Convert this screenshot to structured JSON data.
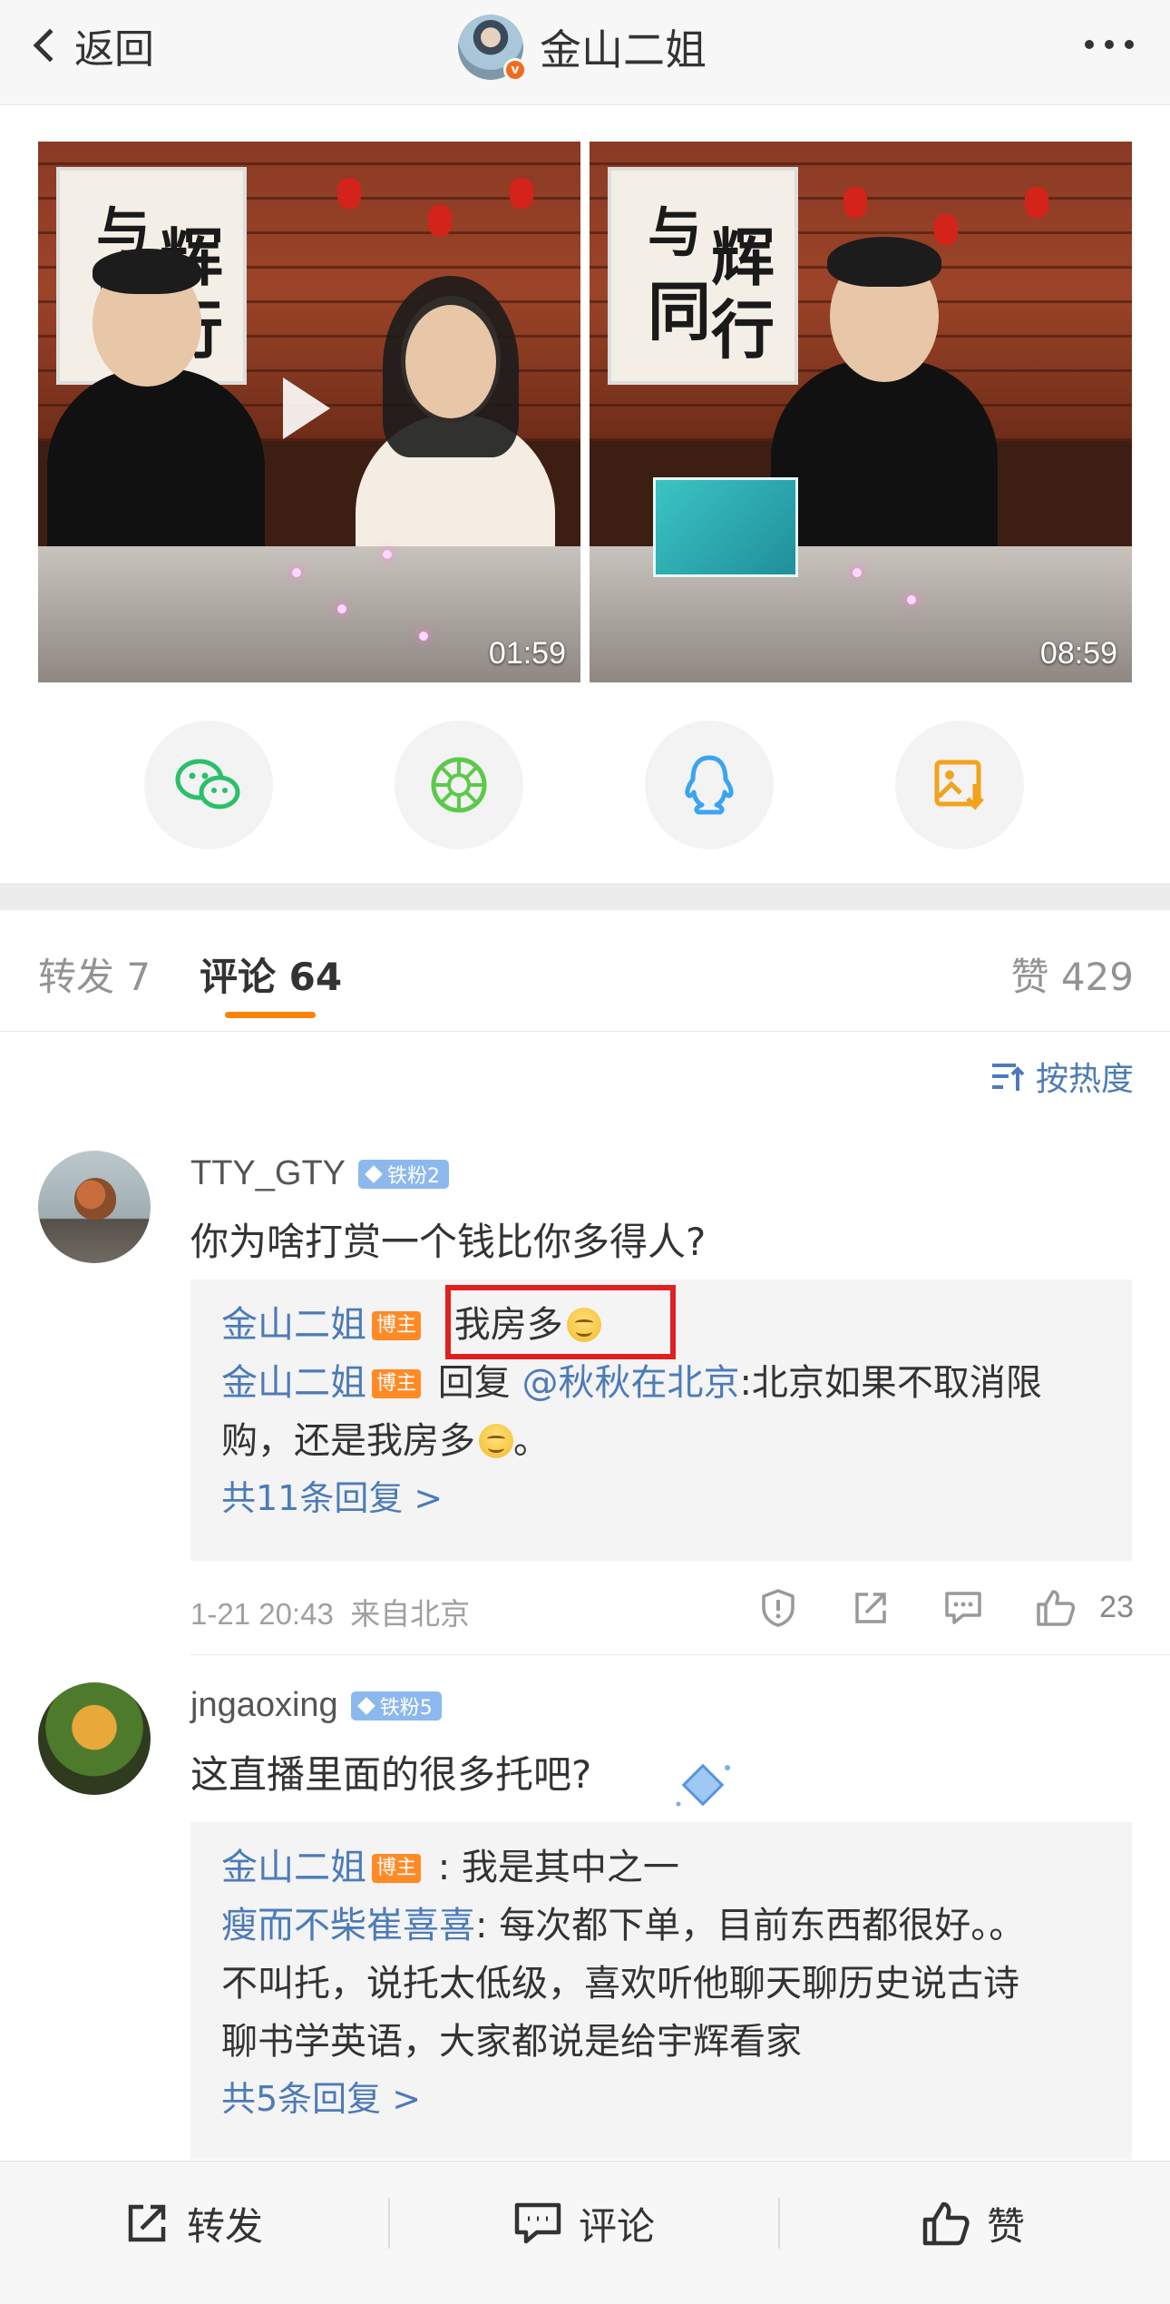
{
  "header": {
    "back_label": "返回",
    "author_name": "金山二姐"
  },
  "media": [
    {
      "duration": "01:59",
      "poster_text": [
        "与",
        "辉",
        "同",
        "行"
      ]
    },
    {
      "duration": "08:59",
      "poster_text": [
        "与",
        "辉",
        "同",
        "行"
      ]
    }
  ],
  "share": [
    {
      "icon": "wechat-icon"
    },
    {
      "icon": "moments-icon"
    },
    {
      "icon": "qq-icon"
    },
    {
      "icon": "save-image-icon"
    }
  ],
  "tabs": {
    "repost": "转发 7",
    "comments": "评论 64",
    "likes": "赞 429"
  },
  "sort_label": "按热度",
  "comments": [
    {
      "user": "TTY_GTY",
      "fan_badge": "铁粉2",
      "text": "你为啥打赏一个钱比你多得人?",
      "replies": [
        {
          "user": "金山二姐",
          "badge": "博主",
          "text": "我房多"
        },
        {
          "user": "金山二姐",
          "badge": "博主",
          "prefix": "回复",
          "mention": "@秋秋在北京",
          "text_a": ":北京如果不取消限",
          "text_b": "购，还是我房多",
          "text_c": "。"
        }
      ],
      "more_replies": "共11条回复 >",
      "time": "1-21 20:43",
      "location": "来自北京",
      "likes": "23"
    },
    {
      "user": "jngaoxing",
      "fan_badge": "铁粉5",
      "text": "这直播里面的很多托吧?",
      "replies": [
        {
          "user": "金山二姐",
          "badge": "博主",
          "text": " : 我是其中之一"
        },
        {
          "user": "瘦而不柴崔喜喜",
          "text_a": ": 每次都下单，目前东西都很好。。",
          "text_b": "不叫托，说托太低级，喜欢听他聊天聊历史说古诗",
          "text_c": "聊书学英语，大家都说是给宇辉看家"
        }
      ],
      "more_replies": "共5条回复 >"
    }
  ],
  "bottom_bar": {
    "repost": "转发",
    "comment": "评论",
    "like": "赞"
  }
}
